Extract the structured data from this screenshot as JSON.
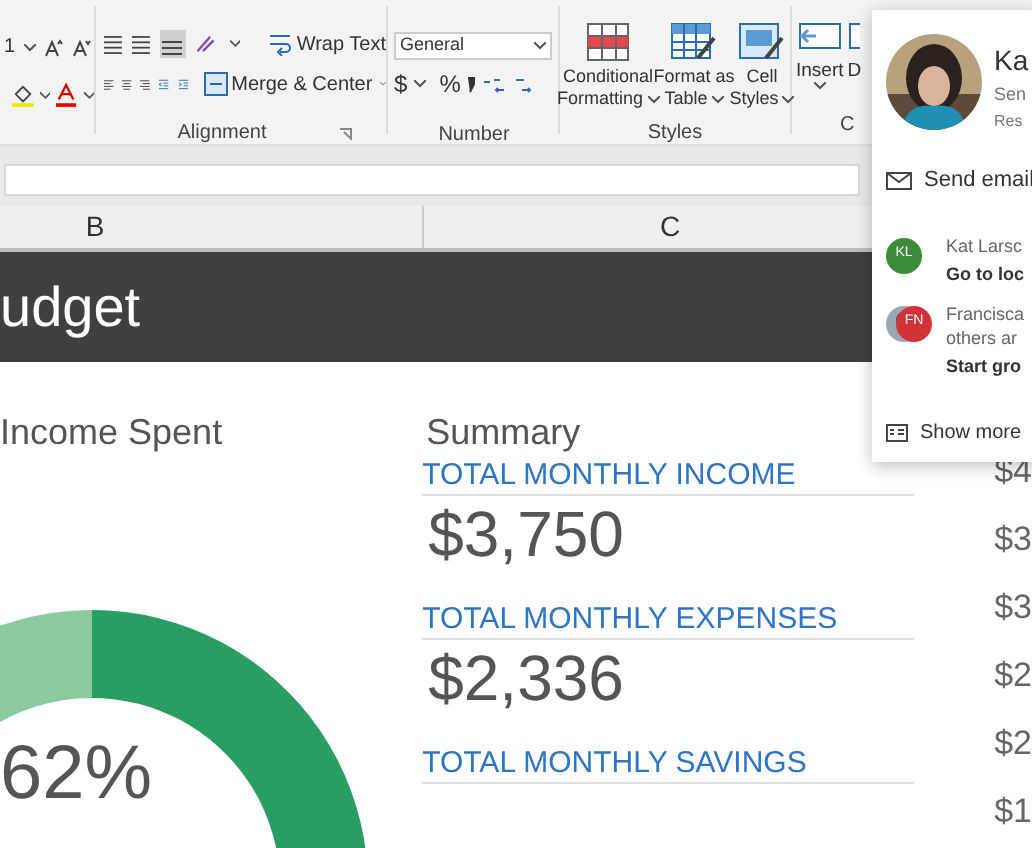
{
  "ribbon": {
    "font": {
      "size": "1"
    },
    "alignment": {
      "wrap_text": "Wrap Text",
      "merge": "Merge & Center",
      "label": "Alignment"
    },
    "number": {
      "format": "General",
      "currency": "$",
      "percent": "%",
      "label": "Number"
    },
    "styles": {
      "buttons": [
        {
          "line1": "Conditional",
          "line2": "Formatting"
        },
        {
          "line1": "Format as",
          "line2": "Table"
        },
        {
          "line1": "Cell",
          "line2": "Styles"
        }
      ],
      "label": "Styles"
    },
    "cells": {
      "buttons": [
        "Insert",
        "D"
      ],
      "label": "C"
    }
  },
  "columns": [
    "B",
    "C"
  ],
  "sheet": {
    "title": "udget",
    "chart_title": "Income Spent",
    "percent": "62%",
    "summary_title": "Summary",
    "summary": [
      {
        "label": "TOTAL MONTHLY INCOME",
        "value": "$3,750"
      },
      {
        "label": "TOTAL MONTHLY EXPENSES",
        "value": "$2,336"
      },
      {
        "label": "TOTAL MONTHLY SAVINGS"
      }
    ],
    "axis_labels": [
      "$4",
      "$3",
      "$3",
      "$2",
      "$2",
      "$1"
    ]
  },
  "contact_card": {
    "name": "Ka",
    "line1": "Sen",
    "line2": "Res",
    "send_email": "Send email",
    "activity": [
      {
        "kind": "person",
        "initials": "KL",
        "color": "#3c8a3c",
        "text": "Kat Larsc",
        "action": "Go to loc"
      },
      {
        "kind": "group",
        "initials": "FN",
        "color": "#d13438",
        "text": "Francisca",
        "text2": "others ar",
        "action": "Start gro"
      }
    ],
    "show_more": "Show more"
  }
}
